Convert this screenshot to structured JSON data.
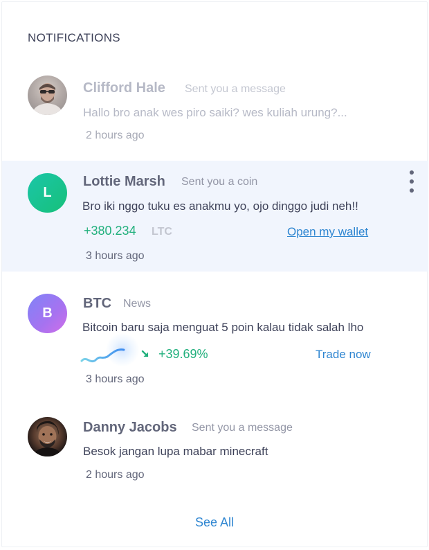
{
  "panel": {
    "title": "NOTIFICATIONS",
    "see_all": "See All"
  },
  "notifications": [
    {
      "name": "Clifford Hale",
      "action": "Sent you a message",
      "message": "Hallo bro anak wes piro saiki? wes kuliah urung?...",
      "time": "2 hours ago",
      "read": true,
      "avatar": "photo"
    },
    {
      "name": "Lottie Marsh",
      "initial": "L",
      "action": "Sent you a coin",
      "message": "Bro iki nggo tuku es anakmu yo, ojo dinggo judi neh!!",
      "amount": "+380.234",
      "currency": "LTC",
      "link": "Open my wallet",
      "time": "3 hours ago",
      "highlighted": true,
      "avatar_color": "#1ec68e"
    },
    {
      "name": "BTC",
      "initial": "B",
      "action": "News",
      "message": "Bitcoin baru saja menguat 5 poin kalau tidak salah lho",
      "change": "+39.69%",
      "link": "Trade now",
      "time": "3 hours ago",
      "avatar_color": "#a772f0"
    },
    {
      "name": "Danny Jacobs",
      "action": "Sent you a message",
      "message": "Besok jangan lupa mabar minecraft",
      "time": "2 hours ago",
      "avatar": "photo"
    }
  ],
  "colors": {
    "positive": "#22b07d",
    "link": "#2f86d1",
    "highlight_bg": "#f1f5fd"
  }
}
